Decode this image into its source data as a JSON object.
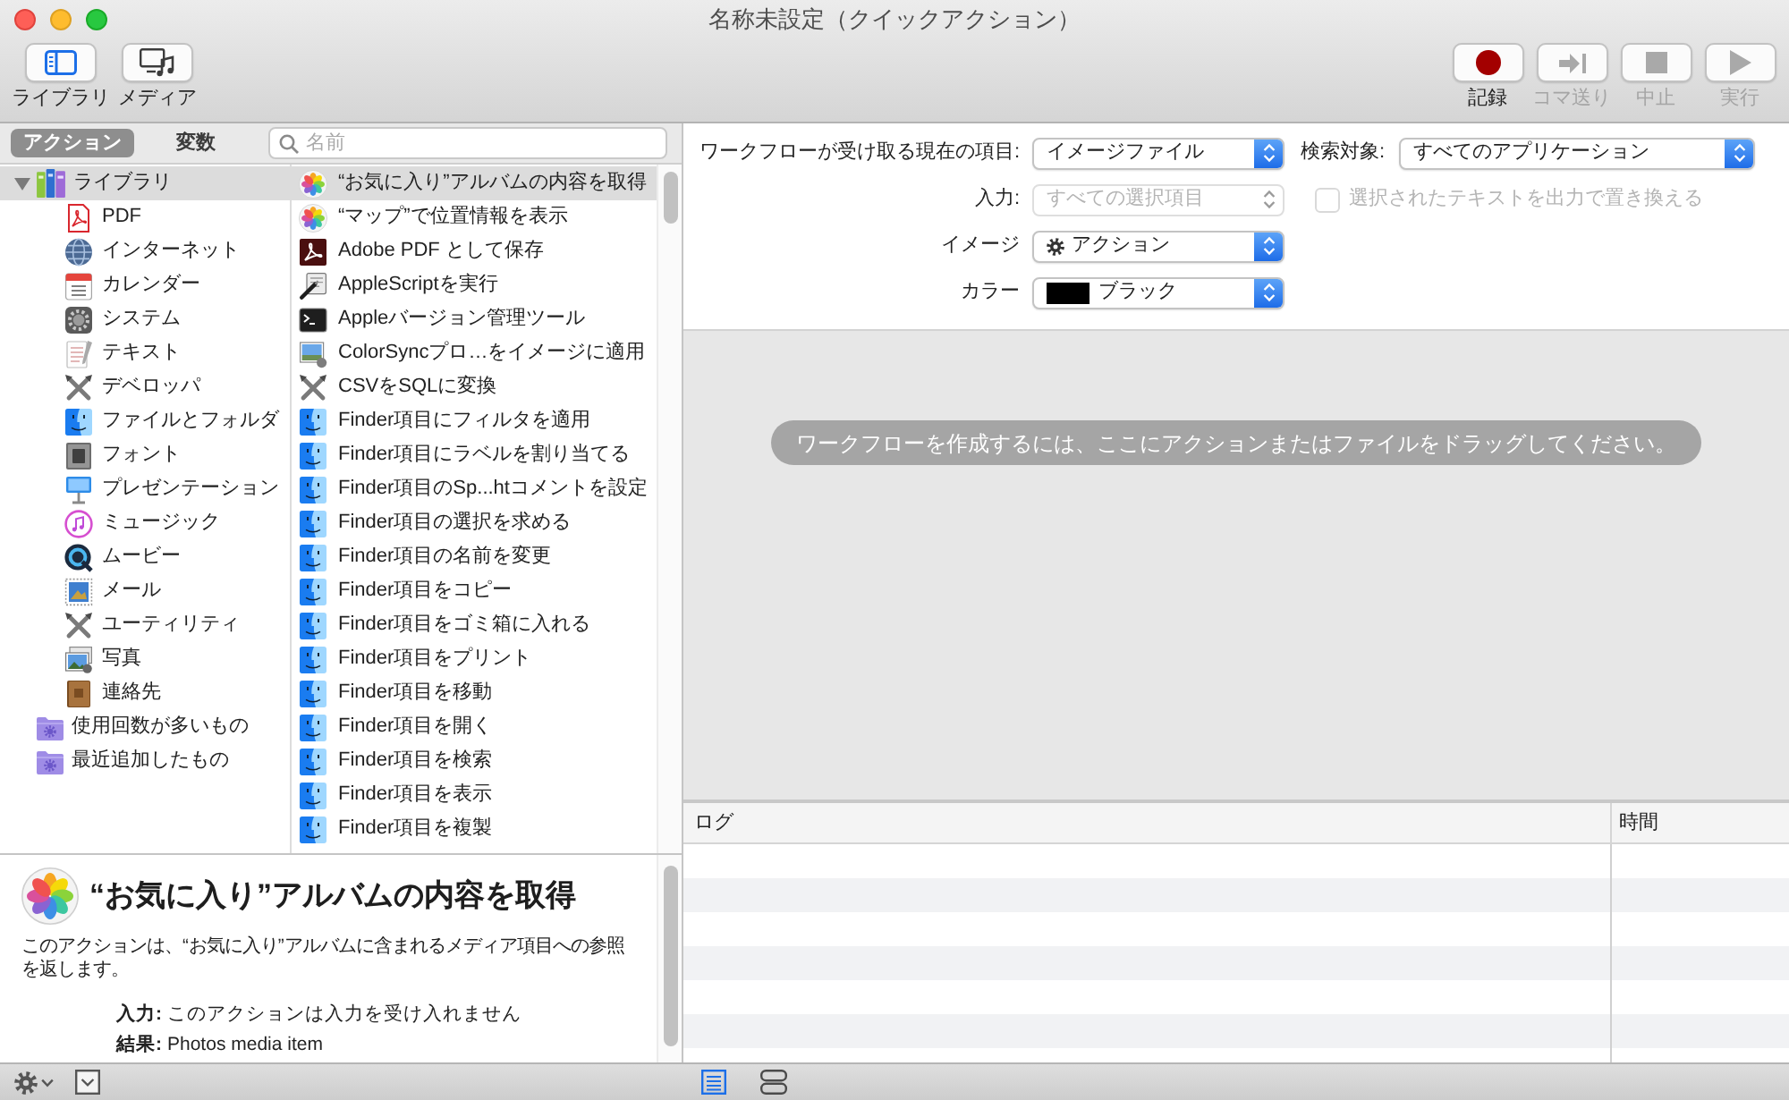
{
  "window": {
    "title": "名称未設定（クイックアクション）"
  },
  "toolbar": {
    "left": [
      {
        "label": "ライブラリ",
        "kind": "library",
        "on": true
      },
      {
        "label": "メディア",
        "kind": "media",
        "on": false
      }
    ],
    "right": [
      {
        "label": "記録",
        "kind": "record",
        "disabled": false
      },
      {
        "label": "コマ送り",
        "kind": "step",
        "disabled": true
      },
      {
        "label": "中止",
        "kind": "stop",
        "disabled": true
      },
      {
        "label": "実行",
        "kind": "run",
        "disabled": true
      }
    ]
  },
  "sidebar": {
    "tabs": [
      {
        "label": "アクション",
        "selected": true
      },
      {
        "label": "変数",
        "selected": false
      }
    ],
    "search": {
      "placeholder": "名前"
    },
    "library": [
      {
        "label": "ライブラリ",
        "kind": "library",
        "selected": true,
        "expanded": true,
        "children": [
          {
            "label": "PDF",
            "kind": "pdf",
            "selected": false
          },
          {
            "label": "インターネット",
            "kind": "internet",
            "selected": false
          },
          {
            "label": "カレンダー",
            "kind": "calendar",
            "selected": false
          },
          {
            "label": "システム",
            "kind": "system",
            "selected": false
          },
          {
            "label": "テキスト",
            "kind": "text",
            "selected": false
          },
          {
            "label": "デベロッパ",
            "kind": "tools",
            "selected": false
          },
          {
            "label": "ファイルとフォルダ",
            "kind": "finder",
            "selected": false
          },
          {
            "label": "フォント",
            "kind": "font",
            "selected": false
          },
          {
            "label": "プレゼンテーション",
            "kind": "presentation",
            "selected": false
          },
          {
            "label": "ミュージック",
            "kind": "music",
            "selected": false
          },
          {
            "label": "ムービー",
            "kind": "movie",
            "selected": false
          },
          {
            "label": "メール",
            "kind": "mail",
            "selected": false
          },
          {
            "label": "ユーティリティ",
            "kind": "tools",
            "selected": false
          },
          {
            "label": "写真",
            "kind": "photo-stack",
            "selected": false
          },
          {
            "label": "連絡先",
            "kind": "contacts",
            "selected": false
          }
        ]
      },
      {
        "label": "使用回数が多いもの",
        "kind": "smart-folder",
        "selected": false
      },
      {
        "label": "最近追加したもの",
        "kind": "smart-folder",
        "selected": false
      }
    ],
    "actions": [
      {
        "label": "“お気に入り”アルバムの内容を取得",
        "kind": "flower",
        "selected": true
      },
      {
        "label": "“マップ”で位置情報を表示",
        "kind": "flower",
        "selected": false
      },
      {
        "label": "Adobe PDF として保存",
        "kind": "acrobat",
        "selected": false
      },
      {
        "label": "AppleScriptを実行",
        "kind": "script",
        "selected": false
      },
      {
        "label": "Appleバージョン管理ツール",
        "kind": "terminal",
        "selected": false
      },
      {
        "label": "ColorSyncプロ…をイメージに適用",
        "kind": "colorsync",
        "selected": false
      },
      {
        "label": "CSVをSQLに変換",
        "kind": "tools",
        "selected": false
      },
      {
        "label": "Finder項目にフィルタを適用",
        "kind": "finder",
        "selected": false
      },
      {
        "label": "Finder項目にラベルを割り当てる",
        "kind": "finder",
        "selected": false
      },
      {
        "label": "Finder項目のSp...htコメントを設定",
        "kind": "finder",
        "selected": false
      },
      {
        "label": "Finder項目の選択を求める",
        "kind": "finder",
        "selected": false
      },
      {
        "label": "Finder項目の名前を変更",
        "kind": "finder",
        "selected": false
      },
      {
        "label": "Finder項目をコピー",
        "kind": "finder",
        "selected": false
      },
      {
        "label": "Finder項目をゴミ箱に入れる",
        "kind": "finder",
        "selected": false
      },
      {
        "label": "Finder項目をプリント",
        "kind": "finder",
        "selected": false
      },
      {
        "label": "Finder項目を移動",
        "kind": "finder",
        "selected": false
      },
      {
        "label": "Finder項目を開く",
        "kind": "finder",
        "selected": false
      },
      {
        "label": "Finder項目を検索",
        "kind": "finder",
        "selected": false
      },
      {
        "label": "Finder項目を表示",
        "kind": "finder",
        "selected": false
      },
      {
        "label": "Finder項目を複製",
        "kind": "finder",
        "selected": false
      }
    ]
  },
  "description": {
    "title": "“お気に入り”アルバムの内容を取得",
    "text": "このアクションは、“お気に入り”アルバムに含まれるメディア項目への参照を返します。",
    "details": [
      {
        "label": "入力:",
        "value": "このアクションは入力を受け入れません"
      },
      {
        "label": "結果:",
        "value": "Photos media item"
      }
    ]
  },
  "settings": {
    "fields": [
      {
        "label": "ワークフローが受け取る現在の項目:",
        "value": "イメージファイル",
        "kind": "text",
        "disabled": false
      },
      {
        "label": "入力:",
        "value": "すべての選択項目",
        "kind": "text",
        "disabled": true
      },
      {
        "label": "イメージ",
        "value": "アクション",
        "kind": "icon",
        "disabled": false
      },
      {
        "label": "カラー",
        "value": "ブラック",
        "kind": "swatch",
        "color": "#000000",
        "disabled": false
      }
    ],
    "search_scope": {
      "label": "検索対象:",
      "value": "すべてのアプリケーション",
      "disabled": false
    },
    "replace_option": {
      "label": "選択されたテキストを出力で置き換える",
      "checked": false,
      "disabled": true
    }
  },
  "canvas": {
    "hint": "ワークフローを作成するには、ここにアクションまたはファイルをドラッグしてください。"
  },
  "log": {
    "columns": [
      "ログ",
      "時間"
    ]
  },
  "bottom_bar": {
    "views": [
      {
        "kind": "list",
        "selected": true
      },
      {
        "kind": "split",
        "selected": false
      }
    ]
  }
}
